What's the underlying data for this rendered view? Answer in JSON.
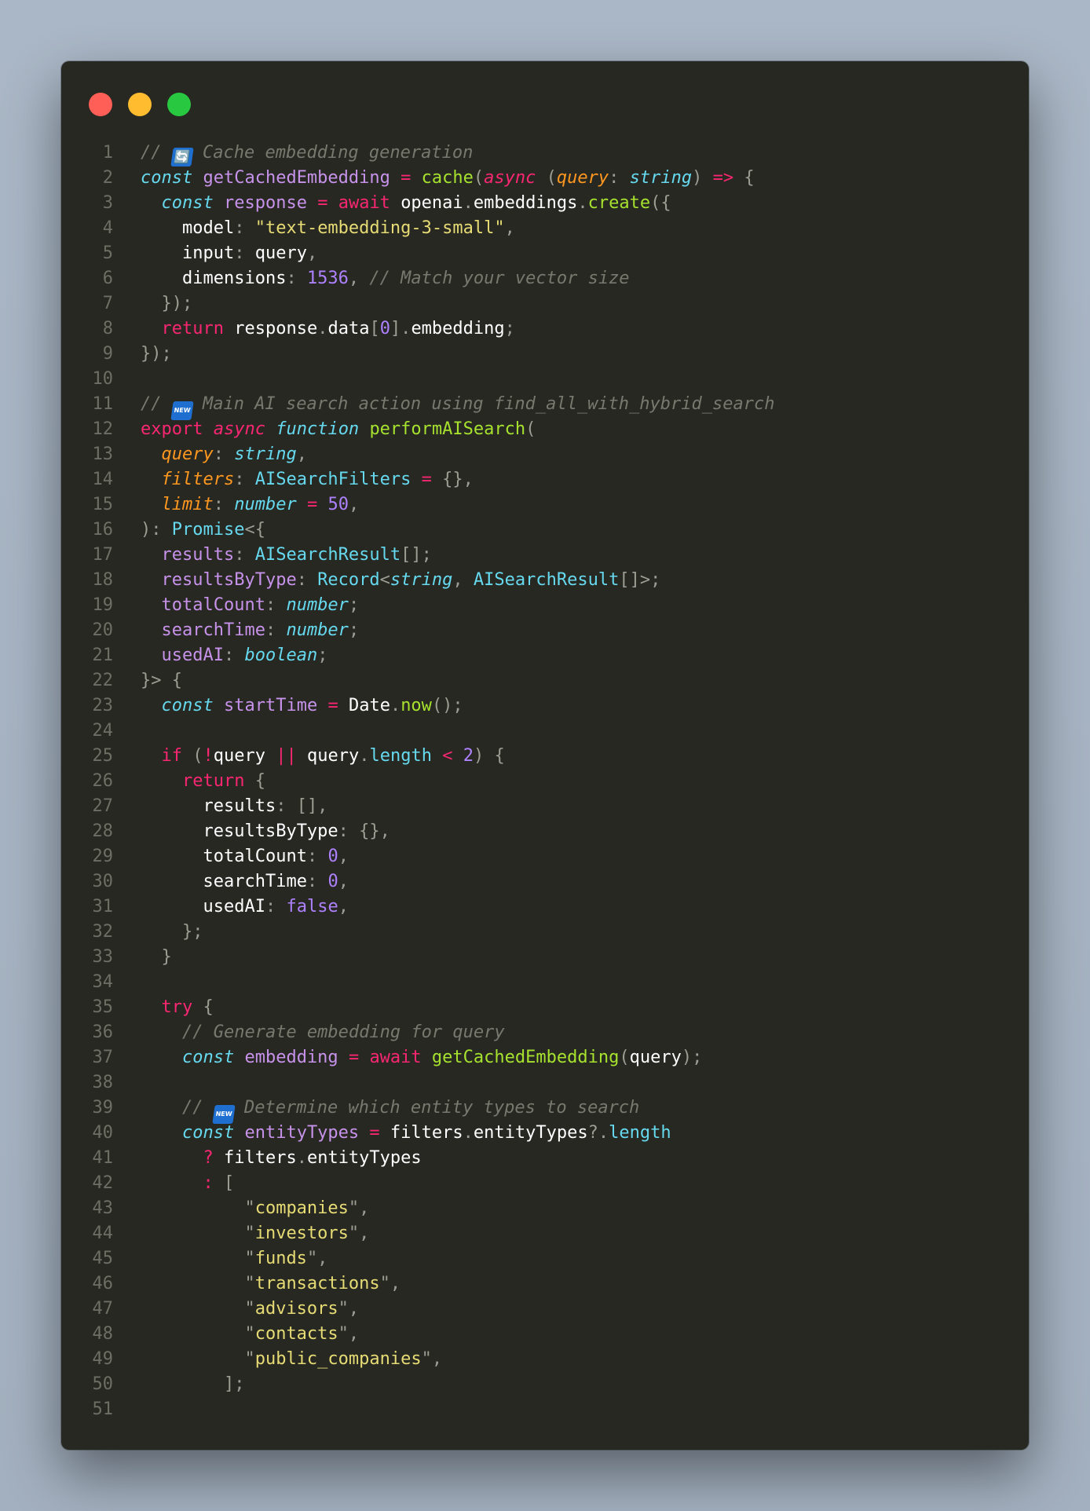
{
  "window": {
    "controls": [
      "close",
      "minimize",
      "maximize"
    ],
    "colors": {
      "close": "#ff5f57",
      "minimize": "#febc2e",
      "maximize": "#28c840",
      "background": "#272822"
    }
  },
  "emoji": {
    "sync": "🔄",
    "new": "NEW"
  },
  "editor": {
    "line_numbers": [
      "1",
      "2",
      "3",
      "4",
      "5",
      "6",
      "7",
      "8",
      "9",
      "10",
      "11",
      "12",
      "13",
      "14",
      "15",
      "16",
      "17",
      "18",
      "19",
      "20",
      "21",
      "22",
      "23",
      "24",
      "25",
      "26",
      "27",
      "28",
      "29",
      "30",
      "31",
      "32",
      "33",
      "34",
      "35",
      "36",
      "37",
      "38",
      "39",
      "40",
      "41",
      "42",
      "43",
      "44",
      "45",
      "46",
      "47",
      "48",
      "49",
      "50",
      "51"
    ],
    "code": {
      "l1": "Cache embedding generation",
      "l2": [
        "const",
        "getCachedEmbedding",
        "cache",
        "async",
        "query",
        "string"
      ],
      "l3": [
        "const",
        "response",
        "await",
        "openai",
        "embeddings",
        "create"
      ],
      "l4": [
        "model",
        "\"text-embedding-3-small\""
      ],
      "l5": [
        "input",
        "query"
      ],
      "l6": [
        "dimensions",
        "1536",
        "// Match your vector size"
      ],
      "l8": [
        "return",
        "response",
        "data",
        "0",
        "embedding"
      ],
      "l11": "Main AI search action using find_all_with_hybrid_search",
      "l12": [
        "export",
        "async",
        "function",
        "performAISearch"
      ],
      "l13": [
        "query",
        "string"
      ],
      "l14": [
        "filters",
        "AISearchFilters"
      ],
      "l15": [
        "limit",
        "number",
        "50"
      ],
      "l16": [
        "Promise"
      ],
      "l17": [
        "results",
        "AISearchResult"
      ],
      "l18": [
        "resultsByType",
        "Record",
        "string",
        "AISearchResult"
      ],
      "l19": [
        "totalCount",
        "number"
      ],
      "l20": [
        "searchTime",
        "number"
      ],
      "l21": [
        "usedAI",
        "boolean"
      ],
      "l23": [
        "const",
        "startTime",
        "Date",
        "now"
      ],
      "l25": [
        "if",
        "query",
        "query",
        "length",
        "2"
      ],
      "l26": [
        "return"
      ],
      "l27": [
        "results"
      ],
      "l28": [
        "resultsByType"
      ],
      "l29": [
        "totalCount",
        "0"
      ],
      "l30": [
        "searchTime",
        "0"
      ],
      "l31": [
        "usedAI",
        "false"
      ],
      "l35": [
        "try"
      ],
      "l36": "// Generate embedding for query",
      "l37": [
        "const",
        "embedding",
        "await",
        "getCachedEmbedding",
        "query"
      ],
      "l39": "Determine which entity types to search",
      "l40": [
        "const",
        "entityTypes",
        "filters",
        "entityTypes",
        "length"
      ],
      "l41": [
        "filters",
        "entityTypes"
      ],
      "l43": "companies",
      "l44": "investors",
      "l45": "funds",
      "l46": "transactions",
      "l47": "advisors",
      "l48": "contacts",
      "l49": "public_companies"
    }
  }
}
